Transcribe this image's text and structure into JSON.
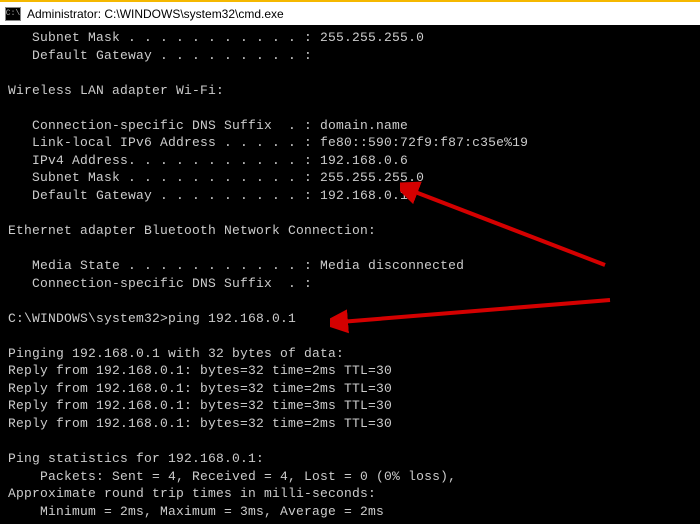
{
  "titlebar": {
    "icon_text": "C:\\",
    "title": "Administrator: C:\\WINDOWS\\system32\\cmd.exe"
  },
  "lines": [
    "   Subnet Mask . . . . . . . . . . . : 255.255.255.0",
    "   Default Gateway . . . . . . . . . :",
    "",
    "Wireless LAN adapter Wi-Fi:",
    "",
    "   Connection-specific DNS Suffix  . : domain.name",
    "   Link-local IPv6 Address . . . . . : fe80::590:72f9:f87:c35e%19",
    "   IPv4 Address. . . . . . . . . . . : 192.168.0.6",
    "   Subnet Mask . . . . . . . . . . . : 255.255.255.0",
    "   Default Gateway . . . . . . . . . : 192.168.0.1",
    "",
    "Ethernet adapter Bluetooth Network Connection:",
    "",
    "   Media State . . . . . . . . . . . : Media disconnected",
    "   Connection-specific DNS Suffix  . :",
    "",
    "C:\\WINDOWS\\system32>ping 192.168.0.1",
    "",
    "Pinging 192.168.0.1 with 32 bytes of data:",
    "Reply from 192.168.0.1: bytes=32 time=2ms TTL=30",
    "Reply from 192.168.0.1: bytes=32 time=2ms TTL=30",
    "Reply from 192.168.0.1: bytes=32 time=3ms TTL=30",
    "Reply from 192.168.0.1: bytes=32 time=2ms TTL=30",
    "",
    "Ping statistics for 192.168.0.1:",
    "    Packets: Sent = 4, Received = 4, Lost = 0 (0% loss),",
    "Approximate round trip times in milli-seconds:",
    "    Minimum = 2ms, Maximum = 3ms, Average = 2ms"
  ],
  "annotation": {
    "arrow_color": "#d40000"
  }
}
